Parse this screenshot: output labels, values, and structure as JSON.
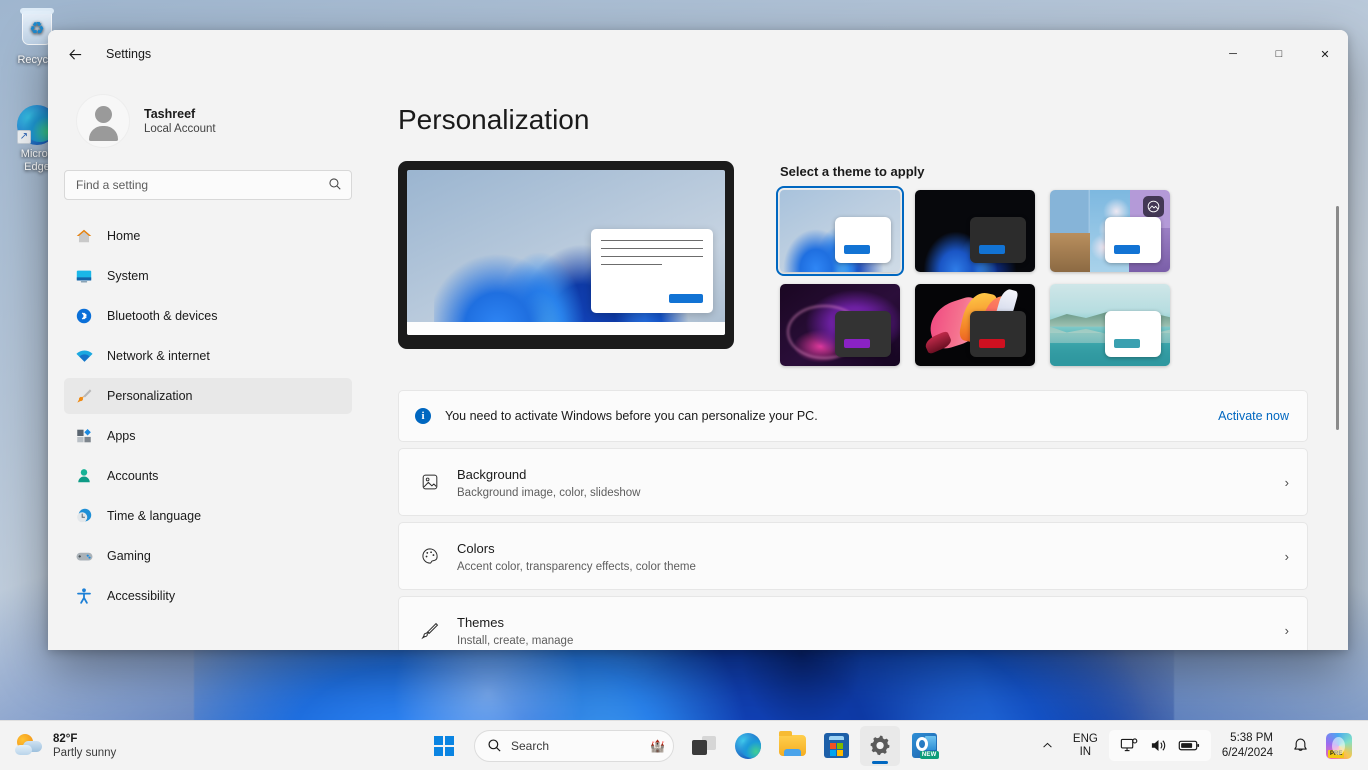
{
  "desktop": {
    "icons": [
      {
        "name": "Recycle",
        "label": "Recycle"
      },
      {
        "name": "Microsoft Edge",
        "label_line1": "Micros",
        "label_line2": "Edge"
      }
    ]
  },
  "window": {
    "title": "Settings",
    "back_icon": "back-arrow-icon",
    "controls": {
      "minimize": "─",
      "maximize": "□",
      "close": "✕"
    }
  },
  "sidebar": {
    "profile": {
      "name": "Tashreef",
      "account_type": "Local Account"
    },
    "search": {
      "placeholder": "Find a setting",
      "value": "",
      "icon": "search-icon"
    },
    "items": [
      {
        "label": "Home",
        "icon": "home-icon",
        "active": false
      },
      {
        "label": "System",
        "icon": "monitor-icon",
        "active": false
      },
      {
        "label": "Bluetooth & devices",
        "icon": "bluetooth-icon",
        "active": false
      },
      {
        "label": "Network & internet",
        "icon": "wifi-icon",
        "active": false
      },
      {
        "label": "Personalization",
        "icon": "paintbrush-icon",
        "active": true
      },
      {
        "label": "Apps",
        "icon": "apps-icon",
        "active": false
      },
      {
        "label": "Accounts",
        "icon": "person-icon",
        "active": false
      },
      {
        "label": "Time & language",
        "icon": "clock-icon",
        "active": false
      },
      {
        "label": "Gaming",
        "icon": "gamepad-icon",
        "active": false
      },
      {
        "label": "Accessibility",
        "icon": "accessibility-icon",
        "active": false
      }
    ]
  },
  "main": {
    "page_title": "Personalization",
    "theme_section_title": "Select a theme to apply",
    "themes": [
      {
        "name": "windows-light",
        "selected": true,
        "badge": false
      },
      {
        "name": "windows-dark",
        "selected": false,
        "badge": false
      },
      {
        "name": "glow-slideshow",
        "selected": false,
        "badge": true,
        "badge_icon": "picture-slideshow-icon"
      },
      {
        "name": "captured-motion-dark",
        "selected": false,
        "badge": false
      },
      {
        "name": "flow-dark",
        "selected": false,
        "badge": false
      },
      {
        "name": "sunrise-light",
        "selected": false,
        "badge": false
      }
    ],
    "banner": {
      "icon": "info-icon",
      "text": "You need to activate Windows before you can personalize your PC.",
      "link": "Activate now"
    },
    "rows": [
      {
        "title": "Background",
        "subtitle": "Background image, color, slideshow",
        "icon": "picture-icon",
        "chevron": "›"
      },
      {
        "title": "Colors",
        "subtitle": "Accent color, transparency effects, color theme",
        "icon": "palette-icon",
        "chevron": "›"
      },
      {
        "title": "Themes",
        "subtitle": "Install, create, manage",
        "icon": "paintbrush-icon",
        "chevron": "›"
      }
    ]
  },
  "taskbar": {
    "weather": {
      "temperature": "82°F",
      "condition": "Partly sunny",
      "icon": "partly-sunny-icon"
    },
    "start_icon": "windows-start-icon",
    "search": {
      "placeholder": "Search",
      "icon": "search-icon",
      "art": "🏰"
    },
    "buttons": [
      {
        "name": "task-view",
        "icon": "task-view-icon",
        "active": false
      },
      {
        "name": "edge",
        "icon": "edge-icon",
        "active": false
      },
      {
        "name": "file-explorer",
        "icon": "folder-icon",
        "active": false
      },
      {
        "name": "microsoft-store",
        "icon": "store-icon",
        "active": false
      },
      {
        "name": "settings",
        "icon": "gear-icon",
        "active": true
      },
      {
        "name": "outlook",
        "icon": "outlook-icon",
        "active": false,
        "badge": "NEW"
      }
    ],
    "tray": {
      "chevron": "⌃",
      "language_line1": "ENG",
      "language_line2": "IN",
      "network_icon": "network-icon",
      "volume_icon": "volume-icon",
      "battery_icon": "battery-icon",
      "time": "5:38 PM",
      "date": "6/24/2024",
      "notification_icon": "bell-icon",
      "copilot_icon": "copilot-icon",
      "copilot_badge": "PRE"
    }
  },
  "colors": {
    "accent": "#0067c0",
    "window_bg": "#f3f3f3",
    "card_bg": "#fbfbfb",
    "text": "#1a1a1a"
  }
}
